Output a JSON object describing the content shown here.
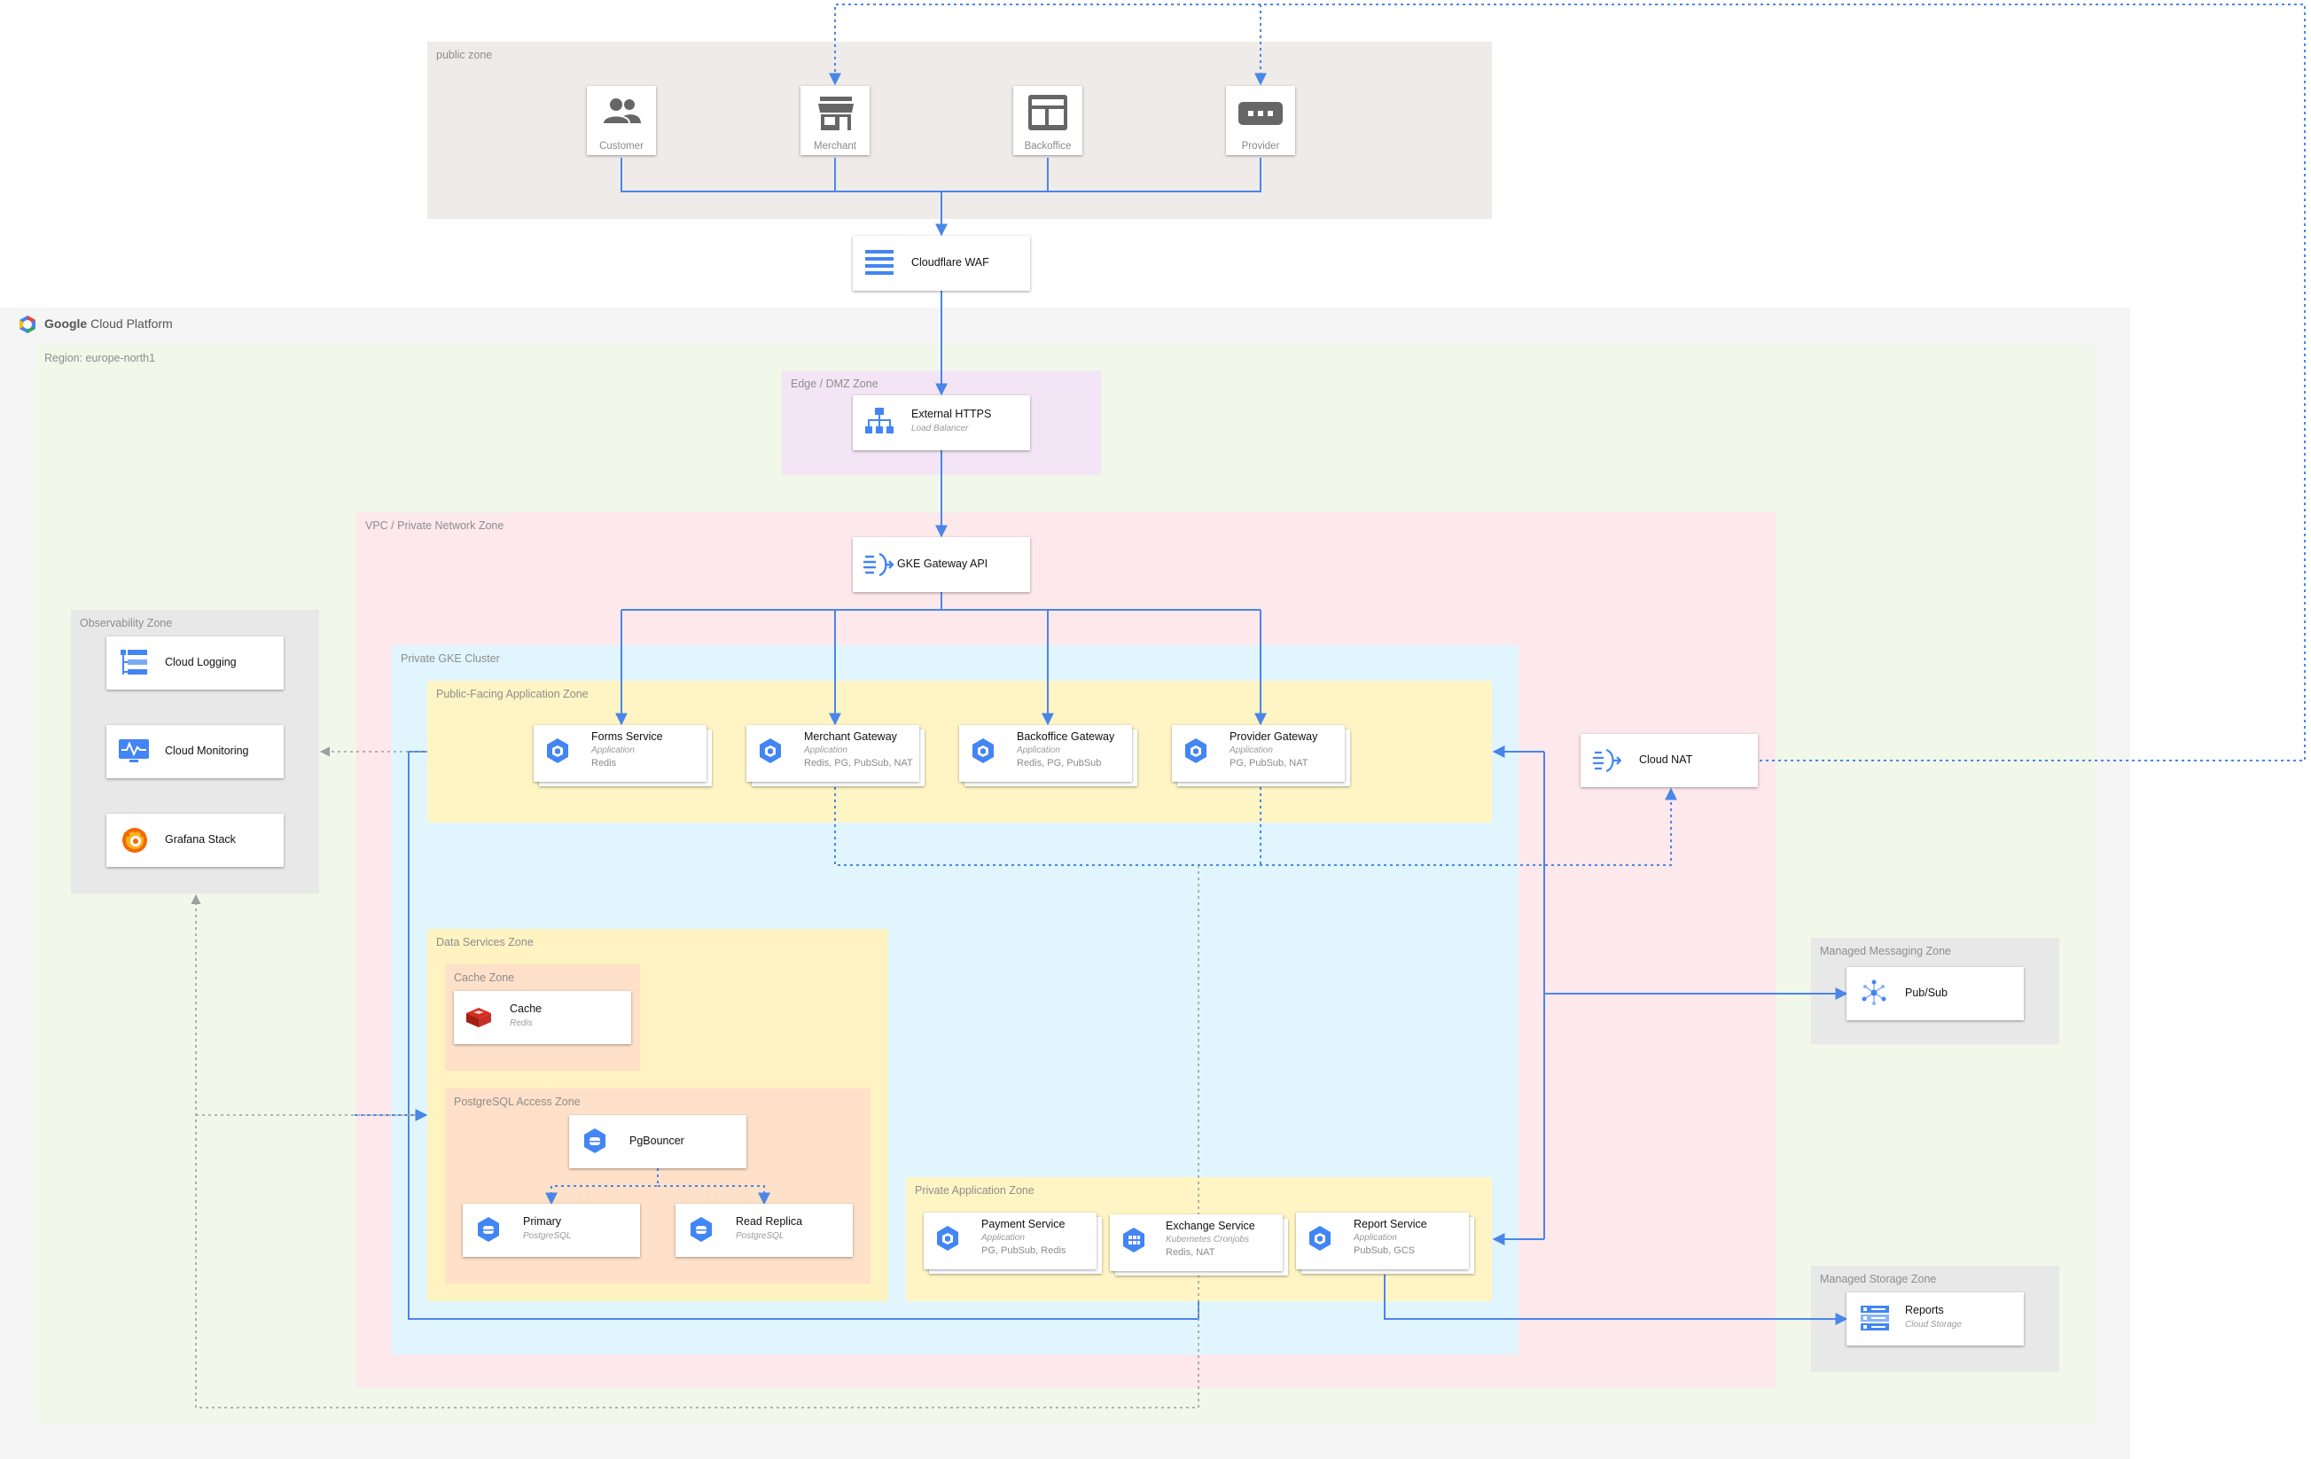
{
  "zones": {
    "public": "public zone",
    "gcp": "Google Cloud Platform",
    "region": "Region: europe-north1",
    "edge": "Edge / DMZ Zone",
    "vpc": "VPC / Private Network Zone",
    "observability": "Observability Zone",
    "gke": "Private GKE Cluster",
    "public_app": "Public-Facing Application Zone",
    "data_services": "Data Services Zone",
    "cache": "Cache Zone",
    "postgres_access": "PostgreSQL Access Zone",
    "private_app": "Private Application Zone",
    "messaging": "Managed Messaging Zone",
    "storage": "Managed Storage Zone"
  },
  "gcp_brand": {
    "google": "Google",
    "rest": "Cloud Platform"
  },
  "clients": [
    {
      "label": "Customer",
      "icon": "people-icon"
    },
    {
      "label": "Merchant",
      "icon": "store-icon"
    },
    {
      "label": "Backoffice",
      "icon": "dashboard-icon"
    },
    {
      "label": "Provider",
      "icon": "provider-icon"
    }
  ],
  "nodes": {
    "waf": {
      "title": "Cloudflare WAF"
    },
    "lb": {
      "title": "External HTTPS",
      "sub": "Load Balancer"
    },
    "gateway_api": {
      "title": "GKE Gateway API"
    },
    "forms": {
      "title": "Forms Service",
      "sub": "Application",
      "extra": "Redis"
    },
    "merchant_gw": {
      "title": "Merchant Gateway",
      "sub": "Application",
      "extra": "Redis, PG, PubSub, NAT"
    },
    "backoffice_gw": {
      "title": "Backoffice Gateway",
      "sub": "Application",
      "extra": "Redis, PG, PubSub"
    },
    "provider_gw": {
      "title": "Provider Gateway",
      "sub": "Application",
      "extra": "PG, PubSub, NAT"
    },
    "cloud_nat": {
      "title": "Cloud NAT"
    },
    "cloud_logging": {
      "title": "Cloud Logging"
    },
    "cloud_monitoring": {
      "title": "Cloud Monitoring"
    },
    "grafana": {
      "title": "Grafana Stack"
    },
    "cache": {
      "title": "Cache",
      "sub": "Redis"
    },
    "pgbouncer": {
      "title": "PgBouncer"
    },
    "primary": {
      "title": "Primary",
      "sub": "PostgreSQL"
    },
    "replica": {
      "title": "Read Replica",
      "sub": "PostgreSQL"
    },
    "payment": {
      "title": "Payment Service",
      "sub": "Application",
      "extra": "PG, PubSub, Redis"
    },
    "exchange": {
      "title": "Exchange Service",
      "sub": "Kubernetes Cronjobs",
      "extra": "Redis, NAT"
    },
    "report": {
      "title": "Report Service",
      "sub": "Application",
      "extra": "PubSub, GCS"
    },
    "pubsub": {
      "title": "Pub/Sub"
    },
    "reports": {
      "title": "Reports",
      "sub": "Cloud Storage"
    }
  },
  "colors": {
    "connector": "#4a86e8",
    "public_zone": "#efebe9",
    "gcp_zone": "#f5f5f5",
    "region_zone": "#f1f8e9",
    "edge_zone": "#f3e5f5",
    "vpc_zone": "#fde8ec",
    "gke_zone": "#e1f5fe",
    "app_zone": "#fff5c4",
    "data_zone": "#fff3c2",
    "sub_zone": "#ffe0c8",
    "managed_zone": "#e8e8e8",
    "gcp_icon_blue": "#4285f4"
  }
}
